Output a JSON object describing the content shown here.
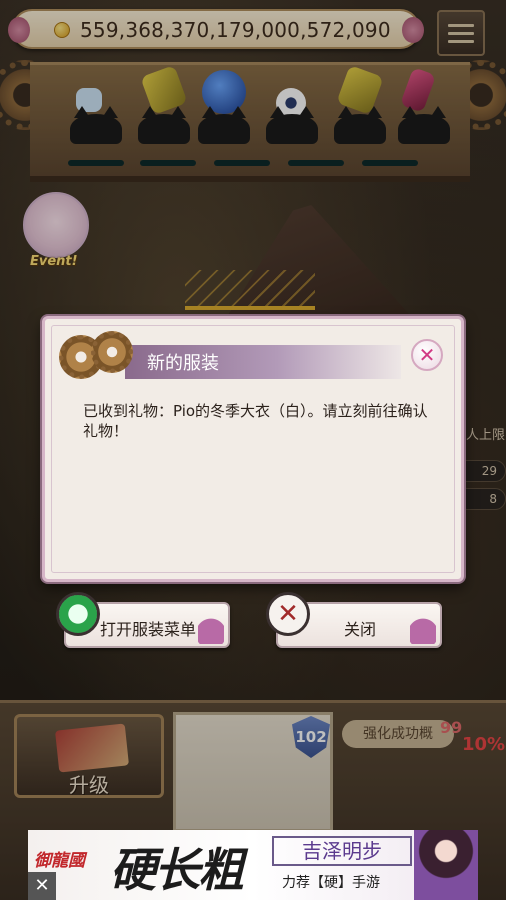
{
  "hud": {
    "coins": "559,368,370,179,000,572,090"
  },
  "event_label": "Event!",
  "background": {
    "right_text": "人上限",
    "right_pill_1": "29",
    "right_pill_2": "8"
  },
  "dialog": {
    "title": "新的服装",
    "message": "已收到礼物：Pio的冬季大衣（白）。请立刻前往确认礼物！",
    "open_label": "打开服装菜单",
    "close_label": "关闭"
  },
  "bottom": {
    "upgrade_label": "升级",
    "level": "102",
    "prob_label": "强化成功概",
    "prob_value": "99",
    "prob_pct": "10%"
  },
  "ad": {
    "logo": "御龍國",
    "headline": "硬长粗",
    "name": "吉泽明步",
    "tagline": "力荐【硬】手游",
    "close": "✕"
  }
}
